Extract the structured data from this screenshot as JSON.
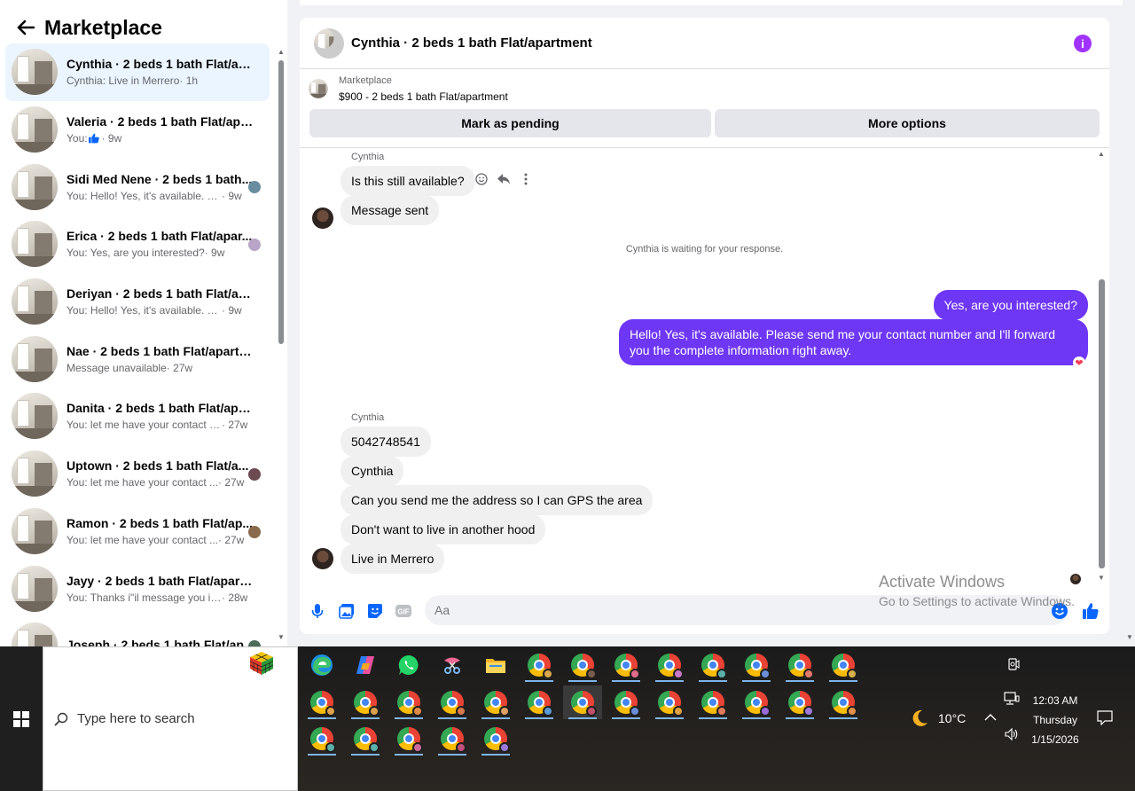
{
  "sidebar": {
    "title": "Marketplace",
    "conversations": [
      {
        "title": "Cynthia · 2 beds 1 bath Flat/apar...",
        "snippet": "Cynthia: Live in Merrero",
        "time": " · 1h",
        "active": true,
        "badge": ""
      },
      {
        "title": "Valeria · 2 beds 1 bath Flat/apart...",
        "snippet": "You: ",
        "time": " · 9w",
        "active": false,
        "badge": "like-icon"
      },
      {
        "title": "Sidi Med Nene · 2 beds 1 bath...",
        "snippet": "You: Hello! Yes, it's available. Ple...",
        "time": " · 9w",
        "active": false,
        "badge": "#6a8ea0"
      },
      {
        "title": "Erica · 2 beds 1 bath Flat/apar...",
        "snippet": "You: Yes, are you interested?",
        "time": " · 9w",
        "active": false,
        "badge": "#b9a5c7"
      },
      {
        "title": "Deriyan · 2 beds 1 bath Flat/apa...",
        "snippet": "You: Hello! Yes, it's available. Pleas...",
        "time": " · 9w",
        "active": false,
        "badge": ""
      },
      {
        "title": "Nae · 2 beds 1 bath Flat/apartm...",
        "snippet": "Message unavailable",
        "time": " · 27w",
        "active": false,
        "badge": ""
      },
      {
        "title": "Danita · 2 beds 1 bath Flat/apart...",
        "snippet": "You: let me have your contact nu...",
        "time": " · 27w",
        "active": false,
        "badge": ""
      },
      {
        "title": "Uptown · 2 beds 1 bath Flat/a...",
        "snippet": "You: let me have your contact ...",
        "time": " · 27w",
        "active": false,
        "badge": "#6d4a52"
      },
      {
        "title": "Ramon · 2 beds 1 bath Flat/ap...",
        "snippet": "You: let me have your contact ...",
        "time": " · 27w",
        "active": false,
        "badge": "#8a6a4c"
      },
      {
        "title": "Jayy · 2 beds 1 bath Flat/apartm...",
        "snippet": "You: Thanks i\"il message you in a ...",
        "time": " · 28w",
        "active": false,
        "badge": ""
      },
      {
        "title": "Joseph · 2 beds 1 bath Flat/ap...",
        "snippet": "",
        "time": "",
        "active": false,
        "badge": "#4c6a5a"
      }
    ]
  },
  "chat": {
    "header_title": "Cynthia · 2 beds 1 bath Flat/apartment",
    "listing_label": "Marketplace",
    "listing_title": "$900 - 2 beds 1 bath Flat/apartment",
    "mark_pending_label": "Mark as pending",
    "more_options_label": "More options",
    "sender_name_1": "Cynthia",
    "msg_in_1": "Is this still available?",
    "msg_in_2": "Message sent",
    "status_note": "Cynthia is waiting for your response.",
    "msg_out_1": "Yes, are you interested?",
    "msg_out_2": "Hello! Yes, it's available. Please send me your contact number and I'll forward you the complete information right away.",
    "sender_name_2": "Cynthia",
    "msg_in_3": "5042748541",
    "msg_in_4": "Cynthia",
    "msg_in_5": "Can you send me the address so I can GPS the area",
    "msg_in_6": "Don't want to live in another hood",
    "msg_in_7": "Live in Merrero",
    "composer_placeholder": "Aa",
    "reaction": "heart",
    "accent_color": "#6e36f5"
  },
  "watermark": {
    "line1": "Activate Windows",
    "line2": "Go to Settings to activate Windows."
  },
  "taskbar": {
    "search_placeholder": "Type here to search",
    "weather_temp": "10°C",
    "time": "12:03 AM",
    "day": "Thursday",
    "date": "1/15/2026",
    "pinned_apps": [
      "edge-icon",
      "copilot-icon",
      "whatsapp-icon",
      "snipping-icon",
      "file-explorer-icon"
    ],
    "chrome_badge_colors": [
      "#d9a64a",
      "#7a5a4a",
      "#e06b8a",
      "#c77ac7",
      "#5bb0a8",
      "#6a8ed8",
      "#e07a6a",
      "#d8b04a",
      "#e0a04a",
      "#d8a050",
      "#e08a4a",
      "#d87a4a",
      "#e0a060",
      "#5a9ad8",
      "#c0506a",
      "#6a8ed8",
      "#e0a040",
      "#e07a5a",
      "#9a6ad8",
      "#a07ad8",
      "#e0904a",
      "#5bb0a8",
      "#5bb0a8",
      "#d06a9a",
      "#c0507a",
      "#9a7ad8"
    ]
  }
}
